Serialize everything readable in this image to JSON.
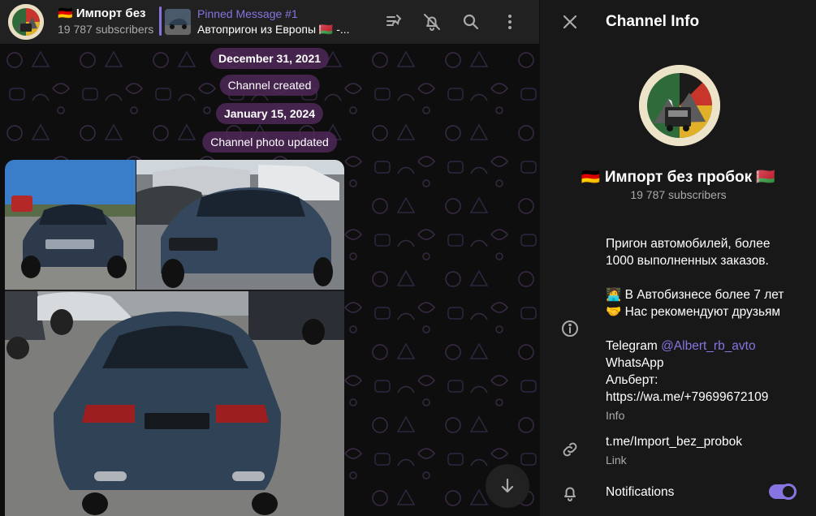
{
  "header": {
    "channel_title": "🇩🇪 Импорт без",
    "subscribers": "19 787 subscribers",
    "pinned_title": "Pinned Message #1",
    "pinned_text": "Автопригон из Европы 🇧🇾 -..."
  },
  "chat": {
    "service_messages": [
      "December 31, 2021",
      "Channel created",
      "January 15, 2024",
      "Channel photo updated"
    ]
  },
  "info": {
    "title": "Channel Info",
    "name": "🇩🇪 Импорт без пробок 🇧🇾",
    "subscribers": "19 787 subscribers",
    "description": {
      "line1": "Пригон автомобилей, более",
      "line2": "1000 выполненных заказов.",
      "line3": "🧑‍💻 В Автобизнесе более 7 лет",
      "line4": "🤝 Нас рекомендуют друзьям",
      "telegram_prefix": "Telegram ",
      "telegram_handle": "@Albert_rb_avto",
      "whatsapp": "WhatsApp",
      "albert": "Альберт:",
      "wa_link": "https://wa.me/+79699672109"
    },
    "description_label": "Info",
    "link": "t.me/Import_bez_probok",
    "link_label": "Link",
    "notifications_label": "Notifications",
    "notifications_on": true
  },
  "colors": {
    "accent": "#8774e1",
    "panel": "#181818",
    "header": "#212121",
    "pill": "#50285a"
  },
  "icons": [
    "channel-avatar",
    "pin-list-icon",
    "mute-icon",
    "search-icon",
    "more-icon",
    "close-icon",
    "info-icon",
    "link-icon",
    "bell-icon",
    "arrow-down-icon"
  ]
}
